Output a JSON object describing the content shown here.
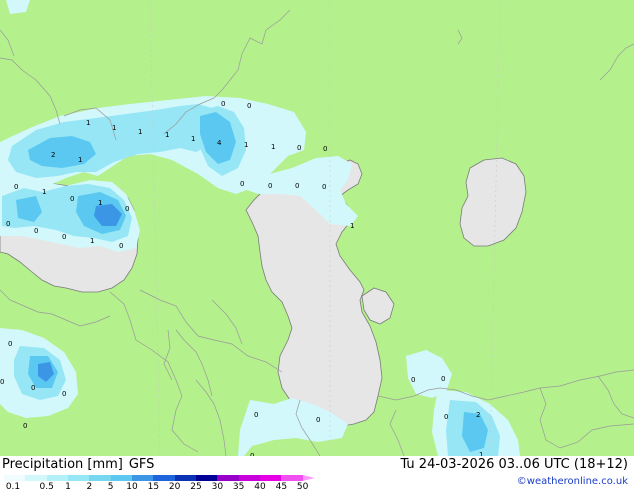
{
  "map": {
    "title": "Precipitation [mm]",
    "model": "GFS",
    "valid_time": "Tu 24-03-2026 03..06 UTC (18+12)",
    "credit": "©weatheronline.co.uk",
    "colors": {
      "land": "#b4f08c",
      "water": "#e6e6e6",
      "border": "#9a9a9a",
      "coast": "#7a7a7a",
      "precip_light": "#d2f8fc",
      "precip_mid": "#96e6f5",
      "precip_heavy": "#5ac8f0",
      "precip_core": "#3c96e6"
    },
    "value_labels": [
      "1",
      "1",
      "1",
      "1",
      "1",
      "2",
      "1",
      "1",
      "4",
      "1",
      "1",
      "1",
      "0",
      "0",
      "0",
      "0",
      "0",
      "0",
      "0",
      "0",
      "0",
      "0",
      "0",
      "0",
      "0",
      "0",
      "1",
      "0",
      "1",
      "0",
      "0",
      "0",
      "0",
      "0",
      "0",
      "0",
      "0",
      "0",
      "2",
      "1",
      "0",
      "0"
    ]
  },
  "legend": {
    "ticks": [
      "0.1",
      "0.5",
      "1",
      "2",
      "5",
      "10",
      "15",
      "20",
      "25",
      "30",
      "35",
      "40",
      "45",
      "50"
    ],
    "colors": [
      "#f0fcff",
      "#d2f8fc",
      "#b4f0f8",
      "#96e6f5",
      "#78d7f0",
      "#5ac8f0",
      "#3c96e6",
      "#1e64dc",
      "#0a32b4",
      "#000096",
      "#9600c8",
      "#c800dc",
      "#e600e6",
      "#f050f0",
      "#fa96fa"
    ]
  }
}
